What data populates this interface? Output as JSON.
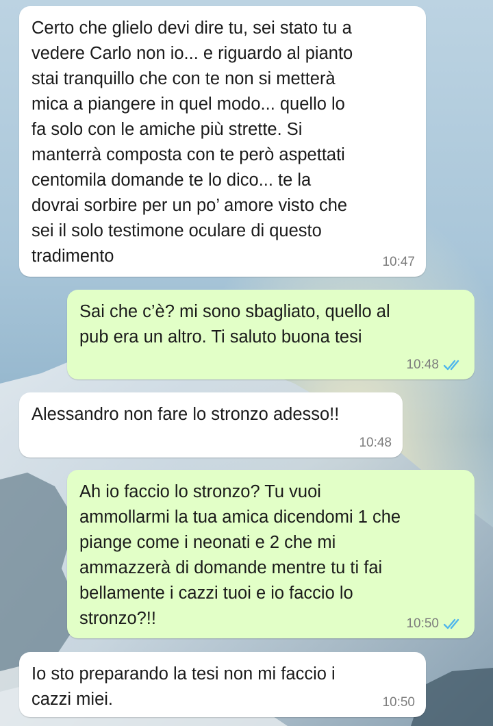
{
  "messages": [
    {
      "direction": "incoming",
      "text": "Certo che glielo devi dire tu, sei stato tu a\nvedere Carlo non io... e riguardo al pianto\nstai tranquillo che con te non si metterà\nmica a piangere in quel modo... quello lo\nfa solo con le amiche più strette. Si\nmanterrà composta con te però aspettati\ncentomila domande te lo dico... te la\ndovrai sorbire per un po’ amore visto che\nsei il solo testimone oculare di questo\ntradimento",
      "time": "10:47"
    },
    {
      "direction": "outgoing",
      "text": "Sai che c’è? mi sono sbagliato, quello al\npub era un altro. Ti saluto buona tesi",
      "time": "10:48",
      "status_icon": "double-check-read-icon"
    },
    {
      "direction": "incoming",
      "text": "Alessandro non fare lo stronzo adesso!!",
      "time": "10:48"
    },
    {
      "direction": "outgoing",
      "text": "Ah io faccio lo stronzo? Tu vuoi\nammollarmi la tua amica dicendomi 1 che\npiange come i neonati e 2 che mi\nammazzerà di domande mentre tu ti fai\nbellamente i cazzi tuoi e io faccio lo\nstronzo?!!",
      "time": "10:50",
      "status_icon": "double-check-read-icon"
    },
    {
      "direction": "incoming",
      "text": "Io sto preparando la tesi non mi faccio i\ncazzi miei.",
      "time": "10:50"
    }
  ],
  "colors": {
    "incoming_bubble": "#ffffff",
    "outgoing_bubble": "#e2ffc7",
    "read_ticks": "#4fb6ec",
    "time_text": "#7c7c7c"
  }
}
